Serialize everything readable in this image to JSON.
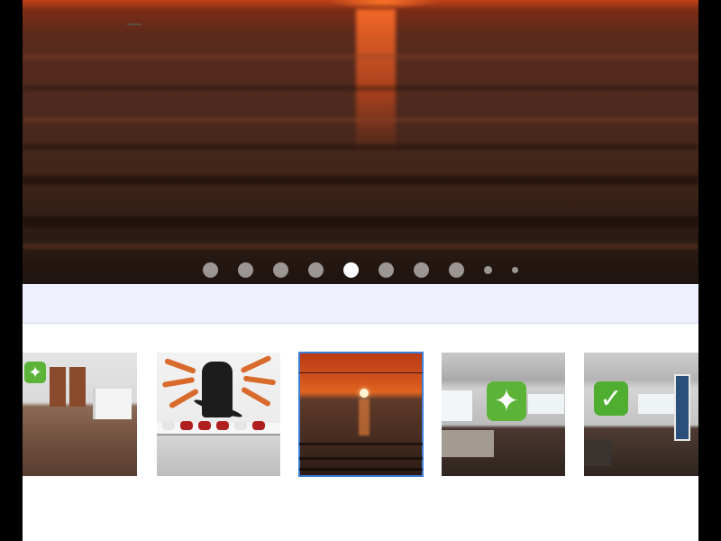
{
  "carousel": {
    "slide_count": 10,
    "current_index": 4,
    "slide_description_icon": "sunset-ocean-photo"
  },
  "thumbnails": [
    {
      "icon": "interior-photo",
      "badge": "sparkle-icon",
      "badge_glyph": "✦"
    },
    {
      "icon": "surf-mural-photo",
      "badge": null,
      "badge_glyph": ""
    },
    {
      "icon": "sunset-photo",
      "badge": null,
      "badge_glyph": "",
      "selected": true
    },
    {
      "icon": "room-window-photo",
      "badge": "sparkle-icon",
      "badge_glyph": "✦"
    },
    {
      "icon": "room-photo",
      "badge": "check-icon",
      "badge_glyph": "✓"
    }
  ],
  "colors": {
    "active_dot": "#ffffff",
    "band": "#eef0ff",
    "selected_outline": "#3f7fd9",
    "badge_green": "#5bb437"
  }
}
